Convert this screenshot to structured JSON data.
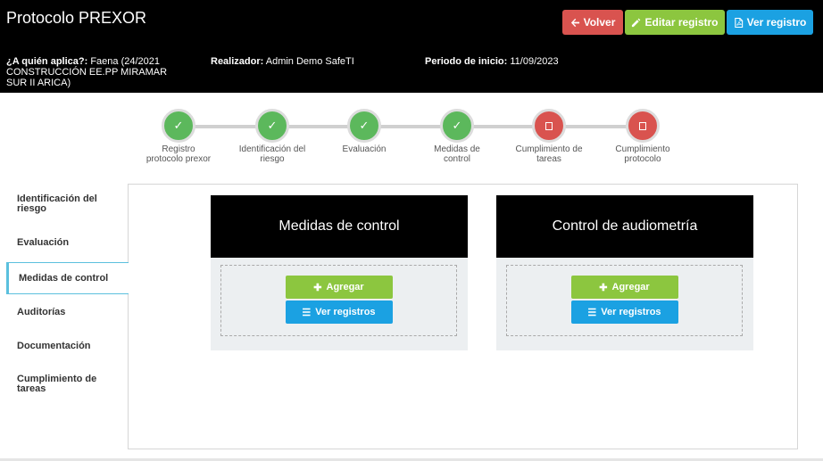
{
  "header": {
    "title": "Protocolo PREXOR",
    "buttons": {
      "back": "Volver",
      "edit": "Editar registro",
      "view": "Ver registro"
    },
    "meta": {
      "applies_label": "¿A quién aplica?:",
      "applies_value": "Faena (24/2021 CONSTRUCCIÓN EE.PP MIRAMAR SUR II ARICA)",
      "realizer_label": "Realizador:",
      "realizer_value": "Admin Demo SafeTI",
      "start_label": "Periodo de inicio:",
      "start_value": "11/09/2023"
    }
  },
  "stepper": [
    {
      "label": "Registro protocolo prexor",
      "status": "done"
    },
    {
      "label": "Identificación del riesgo",
      "status": "done"
    },
    {
      "label": "Evaluación",
      "status": "done"
    },
    {
      "label": "Medidas de control",
      "status": "done"
    },
    {
      "label": "Cumplimiento de tareas",
      "status": "pending"
    },
    {
      "label": "Cumplimiento protocolo",
      "status": "pending"
    }
  ],
  "sidebar": {
    "items": [
      {
        "label": "Identificación del riesgo"
      },
      {
        "label": "Evaluación"
      },
      {
        "label": "Medidas de control",
        "active": true
      },
      {
        "label": "Auditorías"
      },
      {
        "label": "Documentación"
      },
      {
        "label": "Cumplimiento de tareas"
      }
    ]
  },
  "cards": [
    {
      "title": "Medidas de control",
      "add": "Agregar",
      "list": "Ver registros"
    },
    {
      "title": "Control de audiometría",
      "add": "Agregar",
      "list": "Ver registros"
    }
  ],
  "colors": {
    "success": "#5cb85c",
    "danger": "#d9534f",
    "green_button": "#8cc63f",
    "blue_button": "#1ba1e2",
    "active_border": "#5bc0de"
  },
  "icons": {
    "done": "check-icon",
    "pending": "square-icon"
  }
}
